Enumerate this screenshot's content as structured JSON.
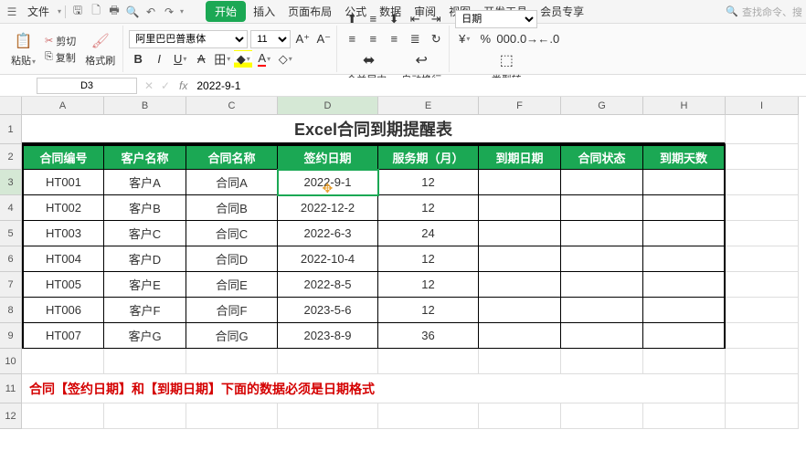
{
  "menu": {
    "file": "文件",
    "tabs": [
      "开始",
      "插入",
      "页面布局",
      "公式",
      "数据",
      "审阅",
      "视图",
      "开发工具",
      "会员专享"
    ],
    "search": "查找命令、搜"
  },
  "ribbon": {
    "paste": "粘贴",
    "cut": "剪切",
    "copy": "复制",
    "format_painter": "格式刷",
    "font_name": "阿里巴巴普惠体",
    "font_size": "11",
    "merge": "合并居中",
    "wrap": "自动换行",
    "number_format": "日期",
    "celltype": "类型转"
  },
  "namebox": "D3",
  "formula": "2022-9-1",
  "columns": [
    "A",
    "B",
    "C",
    "D",
    "E",
    "F",
    "G",
    "H",
    "I"
  ],
  "rows": [
    "1",
    "2",
    "3",
    "4",
    "5",
    "6",
    "7",
    "8",
    "9",
    "10",
    "11",
    "12"
  ],
  "title": "Excel合同到期提醒表",
  "headers": [
    "合同编号",
    "客户名称",
    "合同名称",
    "签约日期",
    "服务期（月）",
    "到期日期",
    "合同状态",
    "到期天数"
  ],
  "data": [
    [
      "HT001",
      "客户A",
      "合同A",
      "2022-9-1",
      "12",
      "",
      "",
      ""
    ],
    [
      "HT002",
      "客户B",
      "合同B",
      "2022-12-2",
      "12",
      "",
      "",
      ""
    ],
    [
      "HT003",
      "客户C",
      "合同C",
      "2022-6-3",
      "24",
      "",
      "",
      ""
    ],
    [
      "HT004",
      "客户D",
      "合同D",
      "2022-10-4",
      "12",
      "",
      "",
      ""
    ],
    [
      "HT005",
      "客户E",
      "合同E",
      "2022-8-5",
      "12",
      "",
      "",
      ""
    ],
    [
      "HT006",
      "客户F",
      "合同F",
      "2023-5-6",
      "12",
      "",
      "",
      ""
    ],
    [
      "HT007",
      "客户G",
      "合同G",
      "2023-8-9",
      "36",
      "",
      "",
      ""
    ]
  ],
  "note": "合同【签约日期】和【到期日期】下面的数据必须是日期格式",
  "chart_data": {
    "type": "table",
    "title": "Excel合同到期提醒表",
    "columns": [
      "合同编号",
      "客户名称",
      "合同名称",
      "签约日期",
      "服务期（月）",
      "到期日期",
      "合同状态",
      "到期天数"
    ],
    "rows": [
      [
        "HT001",
        "客户A",
        "合同A",
        "2022-9-1",
        12,
        null,
        null,
        null
      ],
      [
        "HT002",
        "客户B",
        "合同B",
        "2022-12-2",
        12,
        null,
        null,
        null
      ],
      [
        "HT003",
        "客户C",
        "合同C",
        "2022-6-3",
        24,
        null,
        null,
        null
      ],
      [
        "HT004",
        "客户D",
        "合同D",
        "2022-10-4",
        12,
        null,
        null,
        null
      ],
      [
        "HT005",
        "客户E",
        "合同E",
        "2022-8-5",
        12,
        null,
        null,
        null
      ],
      [
        "HT006",
        "客户F",
        "合同F",
        "2023-5-6",
        12,
        null,
        null,
        null
      ],
      [
        "HT007",
        "客户G",
        "合同G",
        "2023-8-9",
        36,
        null,
        null,
        null
      ]
    ]
  }
}
